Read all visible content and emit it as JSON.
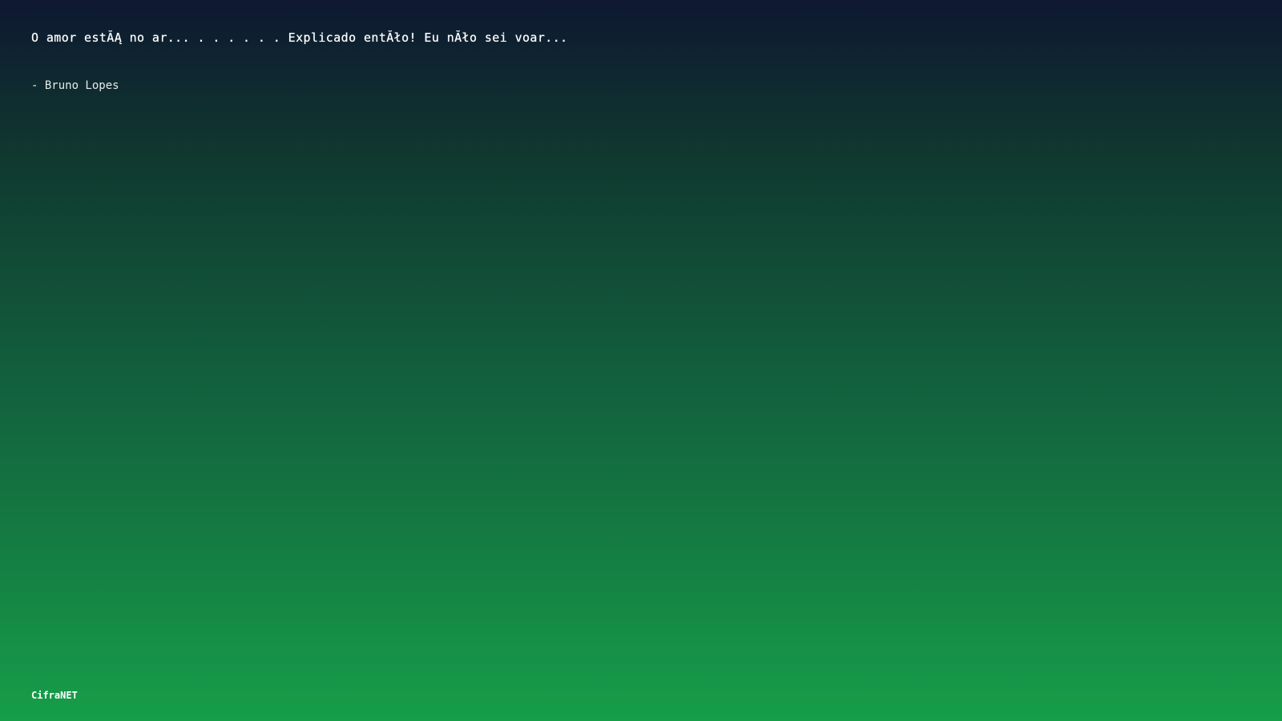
{
  "quote": {
    "text": "O amor estĂĄ no ar... . . . . . . Explicado entĂło! Eu nĂło sei voar...",
    "author": "- Bruno Lopes"
  },
  "footer": {
    "brand": "CifraNET"
  },
  "colors": {
    "background_top": "#0e1830",
    "background_bottom": "#169e49",
    "text": "#ffffff"
  }
}
